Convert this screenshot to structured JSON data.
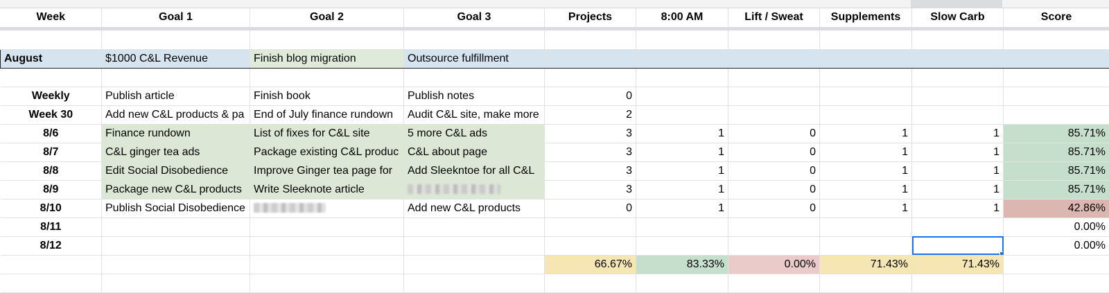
{
  "columns": [
    "Week",
    "Goal 1",
    "Goal 2",
    "Goal 3",
    "Projects",
    "8:00 AM",
    "Lift / Sweat",
    "Supplements",
    "Slow Carb",
    "Score"
  ],
  "month": {
    "label": "August",
    "goal1": "$1000 C&L Revenue",
    "goal2": "Finish blog migration",
    "goal3": "Outsource fulfillment"
  },
  "weekly": {
    "label": "Weekly",
    "goal1": "Publish article",
    "goal2": "Finish book",
    "goal3": "Publish notes",
    "projects": "0"
  },
  "week30": {
    "label": "Week 30",
    "goal1": "Add new C&L products & pa",
    "goal2": "End of July finance rundown",
    "goal3": "Audit C&L site, make more",
    "projects": "2"
  },
  "days": [
    {
      "week": "8/6",
      "goal1": "Finance rundown",
      "goal2": "List of fixes for C&L site",
      "goal3": "5 more C&L ads",
      "projects": "3",
      "am8": "1",
      "lift": "0",
      "supp": "1",
      "carb": "1",
      "score": "85.71%"
    },
    {
      "week": "8/7",
      "goal1": "C&L ginger tea ads",
      "goal2": "Package existing C&L produc",
      "goal3": "C&L about page",
      "projects": "3",
      "am8": "1",
      "lift": "0",
      "supp": "1",
      "carb": "1",
      "score": "85.71%"
    },
    {
      "week": "8/8",
      "goal1": "Edit Social Disobedience",
      "goal2": "Improve Ginger tea page for",
      "goal3": "Add Sleekntoe for all C&L",
      "projects": "3",
      "am8": "1",
      "lift": "0",
      "supp": "1",
      "carb": "1",
      "score": "85.71%"
    },
    {
      "week": "8/9",
      "goal1": "Package new C&L products",
      "goal2": "Write Sleeknote article",
      "goal3": "",
      "projects": "3",
      "am8": "1",
      "lift": "0",
      "supp": "1",
      "carb": "1",
      "score": "85.71%"
    },
    {
      "week": "8/10",
      "goal1": "Publish Social Disobedience",
      "goal2": "",
      "goal3": "Add new C&L products",
      "projects": "0",
      "am8": "1",
      "lift": "0",
      "supp": "1",
      "carb": "1",
      "score": "42.86%"
    },
    {
      "week": "8/11",
      "score": "0.00%"
    },
    {
      "week": "8/12",
      "score": "0.00%"
    }
  ],
  "summary": {
    "projects": "66.67%",
    "am8": "83.33%",
    "lift": "0.00%",
    "supp": "71.43%",
    "carb": "71.43%"
  },
  "colors": {
    "green_cell": "#dde7d5",
    "blue_cell": "#d6e4f0",
    "score_green": "#c6dfcd",
    "score_red": "#dcb7b2",
    "summary_yellow": "#f6e6b4",
    "selection": "#1a73e8"
  }
}
